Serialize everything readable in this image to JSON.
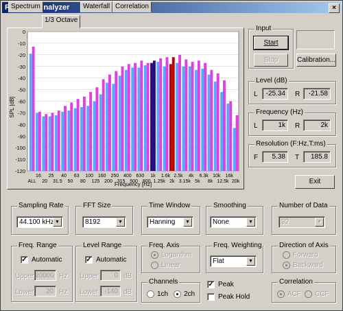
{
  "window": {
    "title": "Realtime Analyzer",
    "close": "×"
  },
  "tabs": [
    "Spectrum",
    "1/3 Octave",
    "Waterfall",
    "Correlation"
  ],
  "chart_data": {
    "type": "bar",
    "ylabel": "SPL [dB]",
    "xlabel": "Frequency  [Hz]",
    "ylim": [
      -120,
      0
    ],
    "yticks": [
      "0",
      "-10",
      "-20",
      "-30",
      "-40",
      "-50",
      "-60",
      "-70",
      "-80",
      "-90",
      "-100",
      "-110",
      "-120"
    ],
    "xtick_row1": [
      "16",
      "25",
      "40",
      "63",
      "100",
      "160",
      "250",
      "400",
      "630",
      "1k",
      "1.6k",
      "2.5k",
      "4k",
      "6.3k",
      "10k",
      "16k"
    ],
    "xtick_row2": [
      "ALL",
      "20",
      "31.5",
      "50",
      "80",
      "125",
      "200",
      "315",
      "500",
      "800",
      "1.25k",
      "2k",
      "3.15k",
      "5k",
      "8k",
      "12.5k",
      "20k"
    ],
    "categories": [
      "ALL",
      "16",
      "20",
      "25",
      "31.5",
      "40",
      "50",
      "63",
      "80",
      "100",
      "125",
      "160",
      "200",
      "250",
      "315",
      "400",
      "500",
      "630",
      "800",
      "1k",
      "1.25k",
      "1.6k",
      "2k",
      "2.5k",
      "3.15k",
      "4k",
      "5k",
      "6.3k",
      "8k",
      "10k",
      "12.5k",
      "16k",
      "20k"
    ],
    "series": [
      {
        "name": "L",
        "color": "#55aaff",
        "values": [
          -19,
          -70,
          -73,
          -73,
          -72,
          -69,
          -68,
          -66,
          -65,
          -64,
          -60,
          -54,
          -44,
          -45,
          -38,
          -33,
          -31,
          -31,
          -29,
          -27,
          -26,
          -30,
          -28,
          -27,
          -30,
          -30,
          -33,
          -32,
          -37,
          -43,
          -52,
          -62,
          -83
        ]
      },
      {
        "name": "R",
        "color": "#e040e0",
        "values": [
          -13,
          -69,
          -71,
          -70,
          -68,
          -64,
          -61,
          -58,
          -56,
          -52,
          -48,
          -41,
          -37,
          -34,
          -30,
          -28,
          -27,
          -25,
          -27,
          -25,
          -23,
          -22,
          -22,
          -20,
          -24,
          -26,
          -25,
          -27,
          -33,
          -36,
          -42,
          -60,
          -72
        ]
      }
    ],
    "markers": [
      {
        "category": "1k",
        "color": "#2a0a80"
      },
      {
        "category": "2k",
        "color": "#c00000"
      }
    ]
  },
  "input": {
    "label": "Input",
    "start": "Start",
    "stop": "Stop",
    "calibration": "Calibration..."
  },
  "level": {
    "label": "Level (dB)",
    "l_label": "L",
    "l_value": "-25.34",
    "r_label": "R",
    "r_value": "-21.58"
  },
  "frequency": {
    "label": "Frequency (Hz)",
    "l_label": "L",
    "l_value": "1k",
    "r_label": "R",
    "r_value": "2k"
  },
  "resolution": {
    "label": "Resolution (F:Hz,T:ms)",
    "f_label": "F",
    "f_value": "5.38",
    "t_label": "T",
    "t_value": "185.8"
  },
  "exit": "Exit",
  "sampling_rate": {
    "label": "Sampling Rate",
    "value": "44.100 kHz"
  },
  "fft_size": {
    "label": "FFT Size",
    "value": "8192"
  },
  "time_window": {
    "label": "Time Window",
    "value": "Hanning"
  },
  "smoothing": {
    "label": "Smoothing",
    "value": "None"
  },
  "number_of_data": {
    "label": "Number of Data",
    "value": "32"
  },
  "freq_range": {
    "label": "Freq. Range",
    "automatic": "Automatic",
    "upper_label": "Upper",
    "upper_value": "20000",
    "upper_unit": "Hz",
    "lower_label": "Lower",
    "lower_value": "20",
    "lower_unit": "Hz"
  },
  "level_range": {
    "label": "Level Range",
    "automatic": "Automatic",
    "upper_label": "Upper",
    "upper_value": "0",
    "upper_unit": "dB",
    "lower_label": "Lower",
    "lower_value": "-140",
    "lower_unit": "dB"
  },
  "freq_axis": {
    "label": "Freq. Axis",
    "logarithm": "Logarithm",
    "linear": "Linear"
  },
  "freq_weighting": {
    "label": "Freq. Weighting",
    "value": "Flat"
  },
  "direction_of_axis": {
    "label": "Direction of Axis",
    "forward": "Forward",
    "backward": "Backward"
  },
  "channels": {
    "label": "Channels",
    "ch1": "1ch",
    "ch2": "2ch"
  },
  "peak": {
    "peak": "Peak",
    "peak_hold": "Peak Hold"
  },
  "correlation": {
    "label": "Correlation",
    "acf": "ACF",
    "ccf": "CCF"
  }
}
